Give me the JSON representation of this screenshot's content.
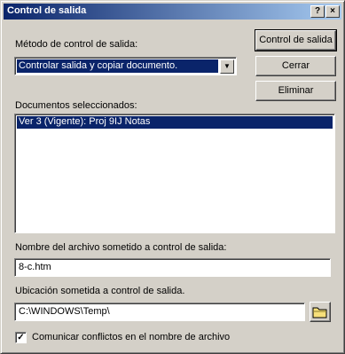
{
  "window": {
    "title": "Control de salida",
    "help_label": "?",
    "close_label": "×"
  },
  "method": {
    "label": "Método de control de salida:",
    "selected": "Controlar salida y copiar documento."
  },
  "buttons": {
    "checkout": "Control de salida",
    "close": "Cerrar",
    "delete": "Eliminar"
  },
  "documents": {
    "label": "Documentos seleccionados:",
    "items": [
      "Ver 3 (Vigente): Proj 9IJ Notas"
    ]
  },
  "filename": {
    "label": "Nombre del archivo sometido a control de salida:",
    "value": "8-c.htm"
  },
  "location": {
    "label": "Ubicación sometida a control de salida.",
    "value": "C:\\WINDOWS\\Temp\\",
    "browse_icon": "folder-icon"
  },
  "conflicts": {
    "label": "Comunicar conflictos en el nombre de archivo",
    "checked": true,
    "check_mark": "✓"
  }
}
